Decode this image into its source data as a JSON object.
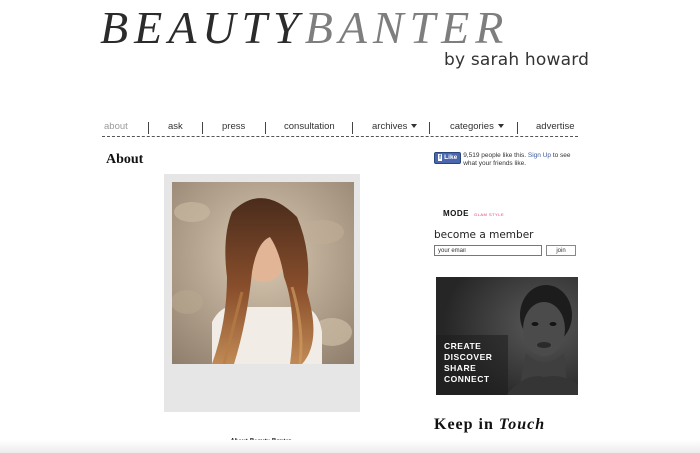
{
  "header": {
    "logo_word1": "BEAUTY",
    "logo_word2": "BANTER",
    "byline": "by sarah howard"
  },
  "nav": {
    "items": [
      {
        "label": "about",
        "active": true
      },
      {
        "label": "ask"
      },
      {
        "label": "press"
      },
      {
        "label": "consultation"
      },
      {
        "label": "archives",
        "dropdown": true
      },
      {
        "label": "categories",
        "dropdown": true
      },
      {
        "label": "advertise"
      }
    ]
  },
  "main": {
    "title": "About",
    "photo_caption": "About Beauty Banter"
  },
  "sidebar": {
    "facebook": {
      "like_label": "Like",
      "count_text": "9,519 people like this.",
      "signup_link": "Sign Up",
      "signup_suffix": "to see what your friends like."
    },
    "mode": {
      "title": "MODE",
      "subtitle": "GLAM STYLE"
    },
    "membership": {
      "heading": "become a member",
      "email_placeholder": "your email",
      "join_label": "join"
    },
    "ad": {
      "lines": [
        "CREATE",
        "DISCOVER",
        "SHARE",
        "CONNECT"
      ]
    },
    "keep_in_touch": {
      "part1": "Keep in",
      "part2": "Touch"
    }
  },
  "colors": {
    "logo_dark": "#2b2b2b",
    "logo_light": "#7e7e7e",
    "nav_active": "#9a9a9a",
    "facebook_blue": "#4a67ad",
    "mode_pink": "#e0337a"
  }
}
